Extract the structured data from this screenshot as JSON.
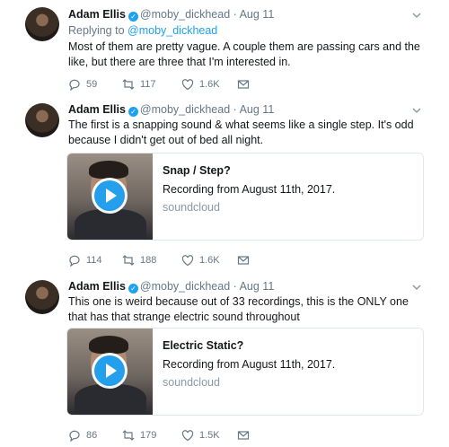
{
  "tweets": [
    {
      "name": "Adam Ellis",
      "handle": "@moby_dickhead",
      "date": "Aug 11",
      "replying_prefix": "Replying to ",
      "replying_to": "@moby_dickhead",
      "text": "Most of them are pretty vague. A couple them are passing cars and the like, but there are three that I'm interested in.",
      "replies": "59",
      "retweets": "117",
      "likes": "1.6K"
    },
    {
      "name": "Adam Ellis",
      "handle": "@moby_dickhead",
      "date": "Aug 11",
      "text": "The first is a snapping sound & what seems like a single step. It's odd because I didn't get out of bed all night.",
      "card": {
        "title": "Snap / Step?",
        "description": "Recording from August 11th, 2017.",
        "domain": "soundcloud"
      },
      "replies": "114",
      "retweets": "188",
      "likes": "1.6K"
    },
    {
      "name": "Adam Ellis",
      "handle": "@moby_dickhead",
      "date": "Aug 11",
      "text": "This one is weird because out of 33 recordings, this is the ONLY one that has that strange electric sound throughout",
      "card": {
        "title": "Electric Static?",
        "description": "Recording from August 11th, 2017.",
        "domain": "soundcloud"
      },
      "replies": "86",
      "retweets": "179",
      "likes": "1.5K"
    }
  ],
  "icons": {
    "reply": "reply-icon",
    "retweet": "retweet-icon",
    "like": "heart-icon",
    "dm": "envelope-icon",
    "verified": "verified-badge-icon",
    "caret": "chevron-down-icon",
    "play": "play-icon"
  },
  "colors": {
    "accent": "#1da1f2",
    "muted": "#657786",
    "text": "#14171a"
  }
}
